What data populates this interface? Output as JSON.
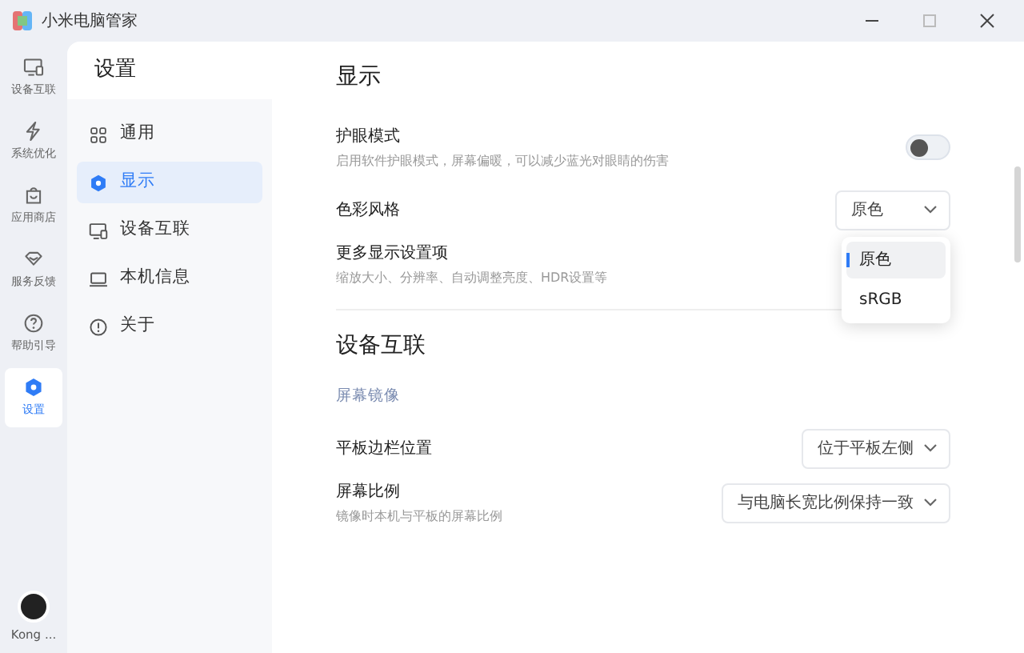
{
  "window": {
    "title": "小米电脑管家"
  },
  "rail": [
    {
      "label": "设备互联",
      "selected": false
    },
    {
      "label": "系统优化",
      "selected": false
    },
    {
      "label": "应用商店",
      "selected": false
    },
    {
      "label": "服务反馈",
      "selected": false
    },
    {
      "label": "帮助引导",
      "selected": false
    },
    {
      "label": "设置",
      "selected": true
    }
  ],
  "user": {
    "name": "Kong ..."
  },
  "nav": {
    "title": "设置",
    "items": [
      {
        "label": "通用",
        "selected": false
      },
      {
        "label": "显示",
        "selected": true
      },
      {
        "label": "设备互联",
        "selected": false
      },
      {
        "label": "本机信息",
        "selected": false
      },
      {
        "label": "关于",
        "selected": false
      }
    ]
  },
  "sections": [
    {
      "title": "显示",
      "rows": [
        {
          "kind": "toggle",
          "label": "护眼模式",
          "description": "启用软件护眼模式，屏幕偏暖，可以减少蓝光对眼睛的伤害",
          "on": false
        },
        {
          "kind": "select",
          "label": "色彩风格",
          "value": "原色",
          "expanded": true,
          "options": [
            {
              "label": "原色",
              "selected": true
            },
            {
              "label": "sRGB",
              "selected": false
            }
          ]
        },
        {
          "kind": "link",
          "label": "更多显示设置项",
          "description": "缩放大小、分辨率、自动调整亮度、HDR设置等"
        }
      ]
    },
    {
      "title": "设备互联",
      "subtitle": "屏幕镜像",
      "rows": [
        {
          "kind": "select",
          "label": "平板边栏位置",
          "value": "位于平板左侧"
        },
        {
          "kind": "select",
          "label": "屏幕比例",
          "description": "镜像时本机与平板的屏幕比例",
          "value": "与电脑长宽比例保持一致"
        }
      ]
    }
  ]
}
